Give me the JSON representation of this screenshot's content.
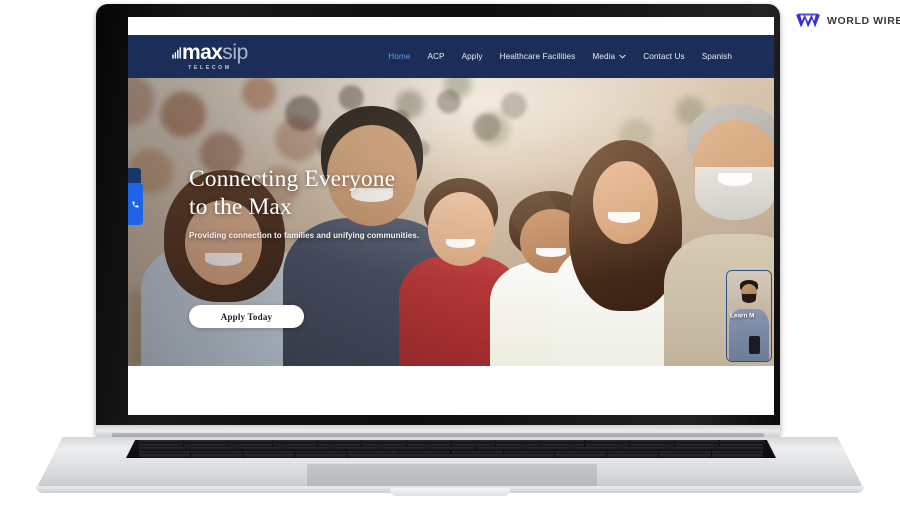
{
  "watermark": {
    "brand": "WORLD WIRE",
    "mark_icon": "world-wire-w-icon",
    "mark_color": "#3730d4",
    "text_color": "#3a3a44"
  },
  "device": {
    "type": "laptop-mockup",
    "bezel_color": "#111111",
    "body_color": "#dfe1e3"
  },
  "site": {
    "nav": {
      "logo": {
        "primary": "max",
        "secondary": "sip",
        "tagline": "TELECOM",
        "signal_icon": "signal-wave-icon"
      },
      "background_color": "#1c2e57",
      "active_color": "#5d9ee8",
      "links": [
        {
          "label": "Home",
          "active": true
        },
        {
          "label": "ACP",
          "active": false
        },
        {
          "label": "Apply",
          "active": false
        },
        {
          "label": "Healthcare Facilities",
          "active": false
        },
        {
          "label": "Media",
          "active": false,
          "dropdown": true,
          "dropdown_icon": "chevron-down-icon"
        },
        {
          "label": "Contact Us",
          "active": false
        },
        {
          "label": "Spanish",
          "active": false
        }
      ]
    },
    "hero": {
      "title_line1": "Connecting Everyone",
      "title_line2": "to the Max",
      "subtitle": "Providing connection to families and unifying communities.",
      "cta_label": "Apply Today",
      "image_alt": "Multi-generational smiling family outdoors at sunset"
    },
    "widgets": {
      "chat": {
        "icon": "phone-chat-icon",
        "color": "#1f63e8"
      },
      "video": {
        "label": "Learn M",
        "icon": "video-popup-icon"
      }
    }
  }
}
